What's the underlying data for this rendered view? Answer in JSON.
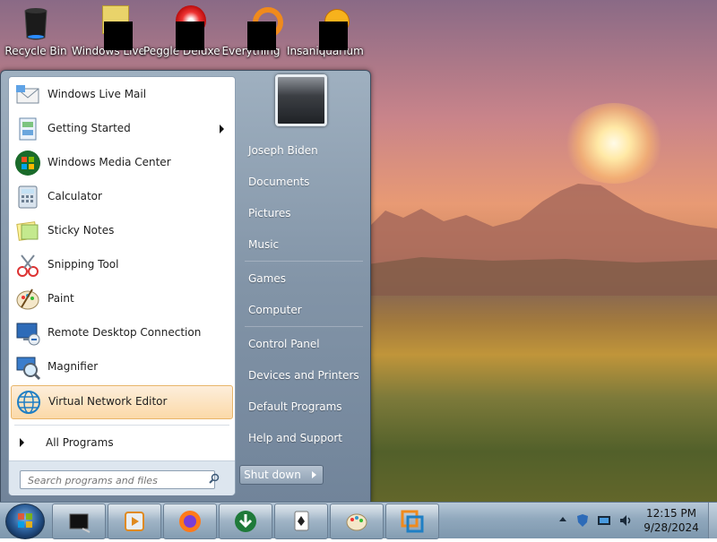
{
  "desktop": {
    "icons": [
      {
        "label": "Recycle Bin",
        "icon": "recycle-bin-icon"
      },
      {
        "label": "Windows Live",
        "icon": "redacted-icon"
      },
      {
        "label": "Peggle Deluxe",
        "icon": "redacted-icon"
      },
      {
        "label": "Everything",
        "icon": "redacted-icon"
      },
      {
        "label": "Insaniquarium",
        "icon": "redacted-icon"
      }
    ]
  },
  "start_menu": {
    "programs": [
      {
        "label": "Windows Live Mail",
        "icon": "mail-icon"
      },
      {
        "label": "Getting Started",
        "icon": "getting-started-icon"
      },
      {
        "label": "Windows Media Center",
        "icon": "windows-logo-icon"
      },
      {
        "label": "Calculator",
        "icon": "calculator-icon"
      },
      {
        "label": "Sticky Notes",
        "icon": "sticky-notes-icon"
      },
      {
        "label": "Snipping Tool",
        "icon": "scissors-icon"
      },
      {
        "label": "Paint",
        "icon": "palette-icon"
      },
      {
        "label": "Remote Desktop Connection",
        "icon": "remote-desktop-icon"
      },
      {
        "label": "Magnifier",
        "icon": "magnifier-icon"
      },
      {
        "label": "Virtual Network Editor",
        "icon": "globe-icon"
      }
    ],
    "all_programs": "All Programs",
    "search_placeholder": "Search programs and files",
    "right": {
      "user": "Joseph Biden",
      "documents": "Documents",
      "pictures": "Pictures",
      "music": "Music",
      "games": "Games",
      "computer": "Computer",
      "control_panel": "Control Panel",
      "devices_printers": "Devices and Printers",
      "default_programs": "Default Programs",
      "help_support": "Help and Support"
    },
    "shutdown": "Shut down"
  },
  "taskbar": {
    "pinned": [
      "terminal-icon",
      "media-player-icon",
      "firefox-icon",
      "download-manager-icon",
      "solitaire-icon",
      "paint-icon",
      "vmware-icon"
    ]
  },
  "tray": {
    "time": "12:15 PM",
    "date": "9/28/2024"
  }
}
